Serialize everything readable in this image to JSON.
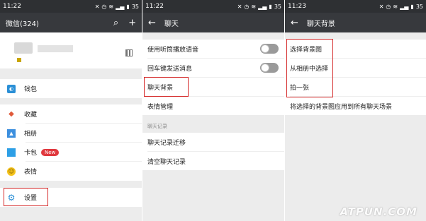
{
  "screen1": {
    "status_time": "11:22",
    "status_right": "35",
    "title": "微信(324)",
    "menu": {
      "wallet": "钱包",
      "favorites": "收藏",
      "album": "相册",
      "cards": "卡包",
      "cards_badge": "New",
      "stickers": "表情",
      "settings": "设置"
    }
  },
  "screen2": {
    "status_time": "11:22",
    "status_right": "35",
    "title": "聊天",
    "rows": {
      "earpiece": "使用听筒播放语音",
      "enter_send": "回车键发送消息",
      "bg": "聊天背景",
      "stickers": "表情管理"
    },
    "history_header": "聊天记录",
    "history": {
      "migrate": "聊天记录迁移",
      "clear": "清空聊天记录"
    }
  },
  "screen3": {
    "status_time": "11:23",
    "status_right": "35",
    "title": "聊天背景",
    "rows": {
      "choose": "选择背景图",
      "from_album": "从相册中选择",
      "take_photo": "拍一张",
      "apply_all": "将选择的背景图应用到所有聊天场景"
    }
  },
  "watermark": "ATPUN.COM",
  "colors": {
    "appbar": "#37393d",
    "statusbar": "#2e3033",
    "highlight": "#d52b2b",
    "badge": "#e0383e"
  }
}
